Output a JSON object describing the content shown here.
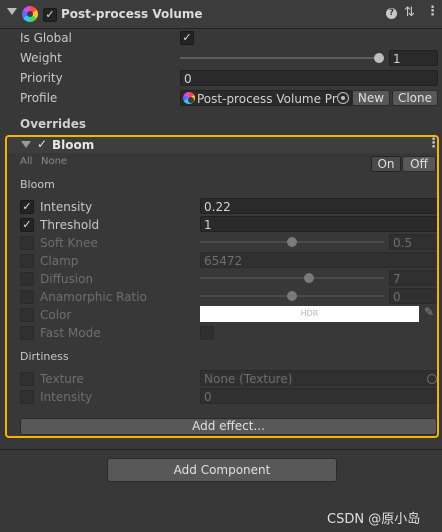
{
  "header": {
    "title": "Post-process Volume",
    "enabled": true
  },
  "volume": {
    "is_global_label": "Is Global",
    "is_global": true,
    "weight_label": "Weight",
    "weight_value": "1",
    "weight_fraction": 1.0,
    "priority_label": "Priority",
    "priority_value": "0",
    "profile_label": "Profile",
    "profile_value": "Post-process Volume Pr",
    "new_label": "New",
    "clone_label": "Clone",
    "overrides_label": "Overrides"
  },
  "bloom": {
    "title": "Bloom",
    "all_label": "All",
    "none_label": "None",
    "on_label": "On",
    "off_label": "Off",
    "section_bloom": "Bloom",
    "section_dirtiness": "Dirtiness",
    "intensity_label": "Intensity",
    "intensity_value": "0.22",
    "threshold_label": "Threshold",
    "threshold_value": "1",
    "soft_knee_label": "Soft Knee",
    "soft_knee_value": "0.5",
    "soft_knee_fraction": 0.5,
    "clamp_label": "Clamp",
    "clamp_value": "65472",
    "diffusion_label": "Diffusion",
    "diffusion_value": "7",
    "diffusion_fraction": 0.6,
    "anamorphic_label": "Anamorphic Ratio",
    "anamorphic_value": "0",
    "anamorphic_fraction": 0.5,
    "color_label": "Color",
    "color_value_text": "HDR",
    "fast_mode_label": "Fast Mode",
    "texture_label": "Texture",
    "texture_value": "None (Texture)",
    "dirt_intensity_label": "Intensity",
    "dirt_intensity_value": "0"
  },
  "add_effect_label": "Add effect...",
  "add_component_label": "Add Component",
  "watermark": "CSDN @原小岛",
  "colors": {
    "highlight": "#f5b400",
    "background": "#383838"
  }
}
